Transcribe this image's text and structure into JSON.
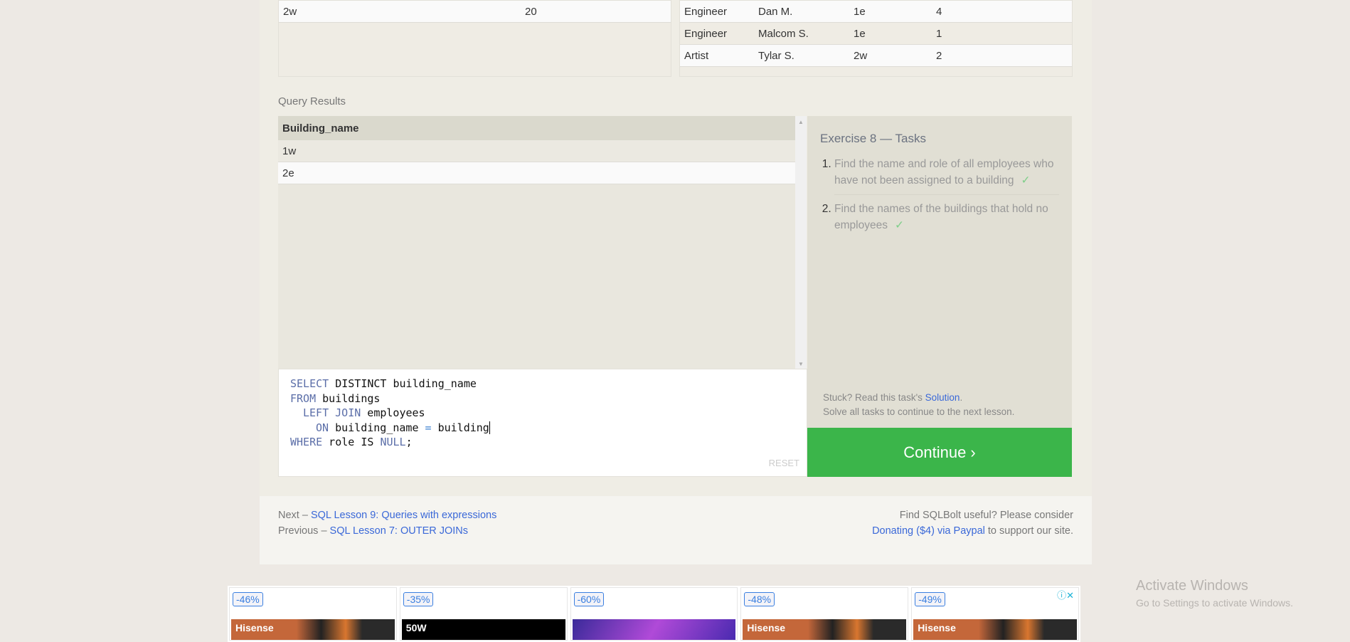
{
  "buildings_table": {
    "rows": [
      [
        "2w",
        "20"
      ]
    ]
  },
  "employees_table": {
    "rows": [
      [
        "Engineer",
        "Dan M.",
        "1e",
        "4"
      ],
      [
        "Engineer",
        "Malcom S.",
        "1e",
        "1"
      ],
      [
        "Artist",
        "Tylar S.",
        "2w",
        "2"
      ]
    ]
  },
  "results": {
    "label": "Query Results",
    "header": "Building_name",
    "rows": [
      "1w",
      "2e"
    ]
  },
  "editor": {
    "lines": [
      [
        "SELECT",
        " DISTINCT building_name"
      ],
      [
        "FROM",
        " buildings"
      ],
      [
        "LEFT JOIN",
        " employees"
      ],
      [
        "ON",
        " building_name ",
        "=",
        " building"
      ],
      [
        "WHERE",
        " role IS ",
        "NULL",
        ";"
      ]
    ],
    "reset": "RESET"
  },
  "tasks": {
    "title": "Exercise 8 — Tasks",
    "items": [
      "Find the name and role of all employees who have not been assigned to a building",
      "Find the names of the buildings that hold no employees"
    ],
    "check": "✓",
    "stuck_prefix": "Stuck? Read this task's ",
    "solution": "Solution",
    "stuck_suffix": ".",
    "solve_all": "Solve all tasks to continue to the next lesson."
  },
  "continue": "Continue ›",
  "footer": {
    "next_prefix": "Next – ",
    "next_link": "SQL Lesson 9: Queries with expressions",
    "prev_prefix": "Previous – ",
    "prev_link": "SQL Lesson 7: OUTER JOINs",
    "useful": "Find SQLBolt useful? Please consider",
    "donate": "Donating ($4) via Paypal",
    "donate_suffix": " to support our site."
  },
  "ads": [
    {
      "discount": "-46%",
      "brand": "Hisense"
    },
    {
      "discount": "-35%",
      "brand": "50W"
    },
    {
      "discount": "-60%",
      "brand": ""
    },
    {
      "discount": "-48%",
      "brand": "Hisense"
    },
    {
      "discount": "-49%",
      "brand": "Hisense"
    }
  ],
  "activate": {
    "title": "Activate Windows",
    "subtitle": "Go to Settings to activate Windows."
  },
  "colors": {
    "continue": "#3bb54a",
    "link": "#3a68d8",
    "keyword": "#5b6ea8"
  }
}
